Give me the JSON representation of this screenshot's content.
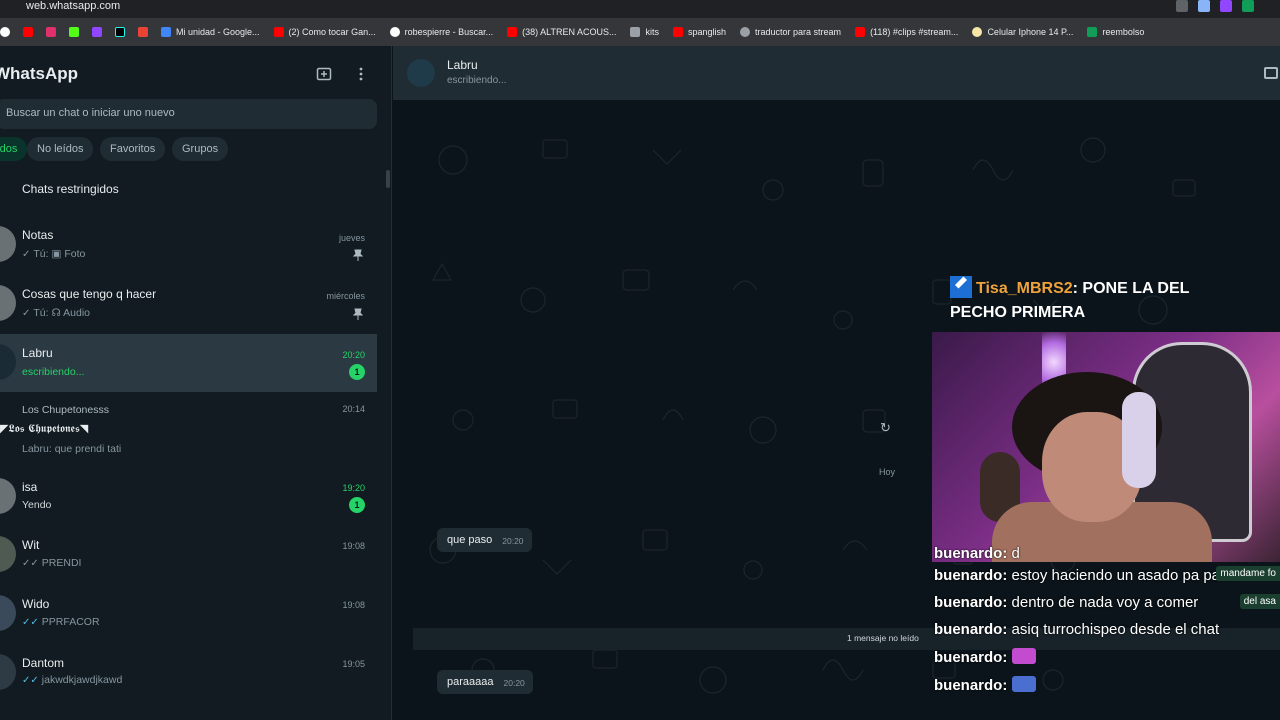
{
  "browser": {
    "url": "web.whatsapp.com",
    "bookmarks": [
      {
        "label": "Mi unidad - Google...",
        "color": "#4285f4"
      },
      {
        "label": "(2) Como tocar Gan...",
        "color": "#ff0000"
      },
      {
        "label": "robespierre - Buscar...",
        "color": "#ffffff"
      },
      {
        "label": "(38) ALTREN ACOUS...",
        "color": "#ff0000"
      },
      {
        "label": "kits",
        "color": "#9aa0a6"
      },
      {
        "label": "spanglish",
        "color": "#ff0000"
      },
      {
        "label": "traductor para stream",
        "color": "#9aa0a6"
      },
      {
        "label": "(118) #clips #stream...",
        "color": "#ff0000"
      },
      {
        "label": "Celular Iphone 14 P...",
        "color": "#f5e6a8"
      },
      {
        "label": "reembolso",
        "color": "#0f9d58"
      }
    ]
  },
  "sidebar": {
    "app_title": "WhatsApp",
    "search_placeholder": "Buscar un chat o iniciar uno nuevo",
    "filters": [
      "Todos",
      "No leídos",
      "Favoritos",
      "Grupos"
    ],
    "restricted_label": "Chats restringidos",
    "chats": [
      {
        "name": "Notas",
        "preview_prefix": "Tú:",
        "preview_icon": "photo-icon",
        "preview": "Foto",
        "time": "jueves",
        "pinned": true
      },
      {
        "name": "Cosas que tengo q hacer",
        "preview_prefix": "Tú:",
        "preview_icon": "headphones-icon",
        "preview": "Audio",
        "time": "miércoles",
        "pinned": true
      },
      {
        "name": "Labru",
        "preview": "escribiendo...",
        "time": "20:20",
        "unread": "1"
      },
      {
        "name": "Los Chupetonesss",
        "title_line": "◤𝕷𝖔𝖘 𝕮𝖍𝖚𝖕𝖊𝖙𝖔𝖓𝖊𝖘◥",
        "preview": "Labru: que prendi tati",
        "time": "20:14"
      },
      {
        "name": "isa",
        "preview": "Yendo",
        "time": "19:20",
        "unread": "1"
      },
      {
        "name": "Wit",
        "preview": "PRENDI",
        "time": "19:08"
      },
      {
        "name": "Wido",
        "preview": "PPRFACOR",
        "time": "19:08"
      },
      {
        "name": "Dantom",
        "preview": "jakwdkjawdjkawd",
        "time": "19:05"
      }
    ]
  },
  "conversation": {
    "contact_name": "Labru",
    "status": "escribiendo...",
    "date_separator": "Hoy",
    "unread_separator": "1 mensaje no leído",
    "messages": [
      {
        "text": "que paso",
        "time": "20:20"
      },
      {
        "text": "paraaaaa",
        "time": "20:20"
      }
    ]
  },
  "stream_overlay": {
    "highlight_user": "Tisa_MBRS2",
    "highlight_text_1": ": PONE LA DEL",
    "highlight_text_2": "PECHO PRIMERA",
    "chat_lines": [
      {
        "user": "buenardo:",
        "text": "d"
      },
      {
        "user": "buenardo:",
        "text": "estoy haciendo un asado pa para"
      },
      {
        "user": "buenardo:",
        "text": "dentro de nada voy a comer"
      },
      {
        "user": "buenardo:",
        "text": "asiq turrochispeo desde el chat"
      },
      {
        "user": "buenardo:",
        "text": ""
      },
      {
        "user": "buenardo:",
        "text": ""
      }
    ],
    "side_tags": [
      "mandame fo",
      "del asa"
    ]
  },
  "colors": {
    "accent": "#25d366",
    "sidebar_bg": "#111b21",
    "panel_bg": "#202c33",
    "conv_bg": "#0b141a"
  }
}
